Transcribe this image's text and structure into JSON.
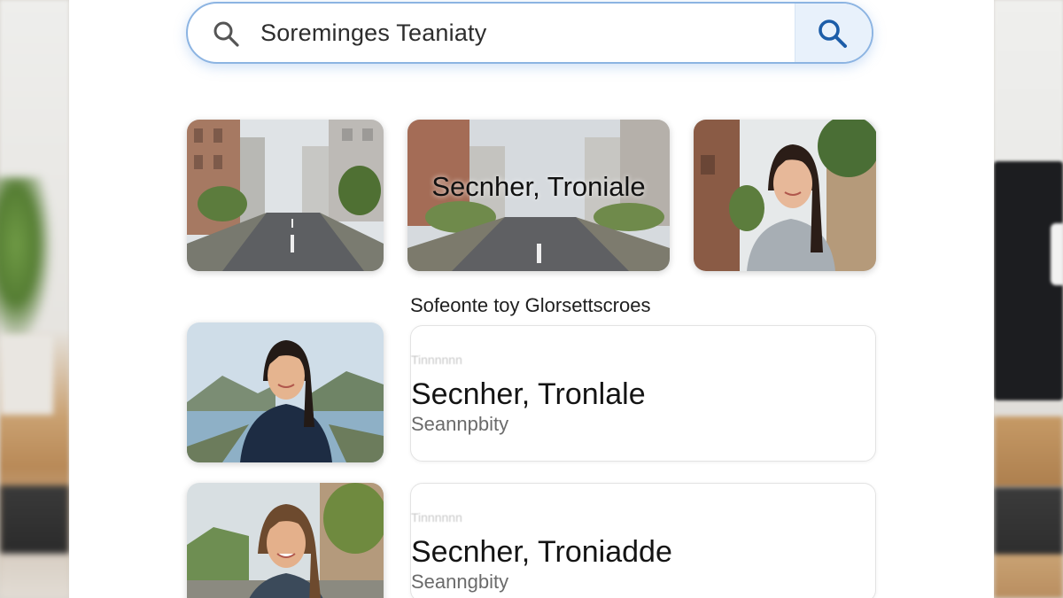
{
  "search": {
    "query": "Soremingеs Teaniaty",
    "leading_icon": "search-icon",
    "submit_icon": "search-icon"
  },
  "gallery": {
    "cards": [
      {
        "type": "street-photo",
        "title": ""
      },
      {
        "type": "street-photo",
        "title": "Secnher, Troniale"
      },
      {
        "type": "portrait-photo",
        "title": ""
      }
    ],
    "caption": "Sofeonte toy Glorsettscroes"
  },
  "results": [
    {
      "faint_label": "Tinnnnnn",
      "name": "Secnher, Tronlale",
      "subtitle": "Seannpbity",
      "thumb": "portrait-river"
    },
    {
      "faint_label": "Tinnnnnn",
      "name": "Secnher, Troniadde",
      "subtitle": "Seanngbity",
      "thumb": "portrait-street"
    }
  ]
}
